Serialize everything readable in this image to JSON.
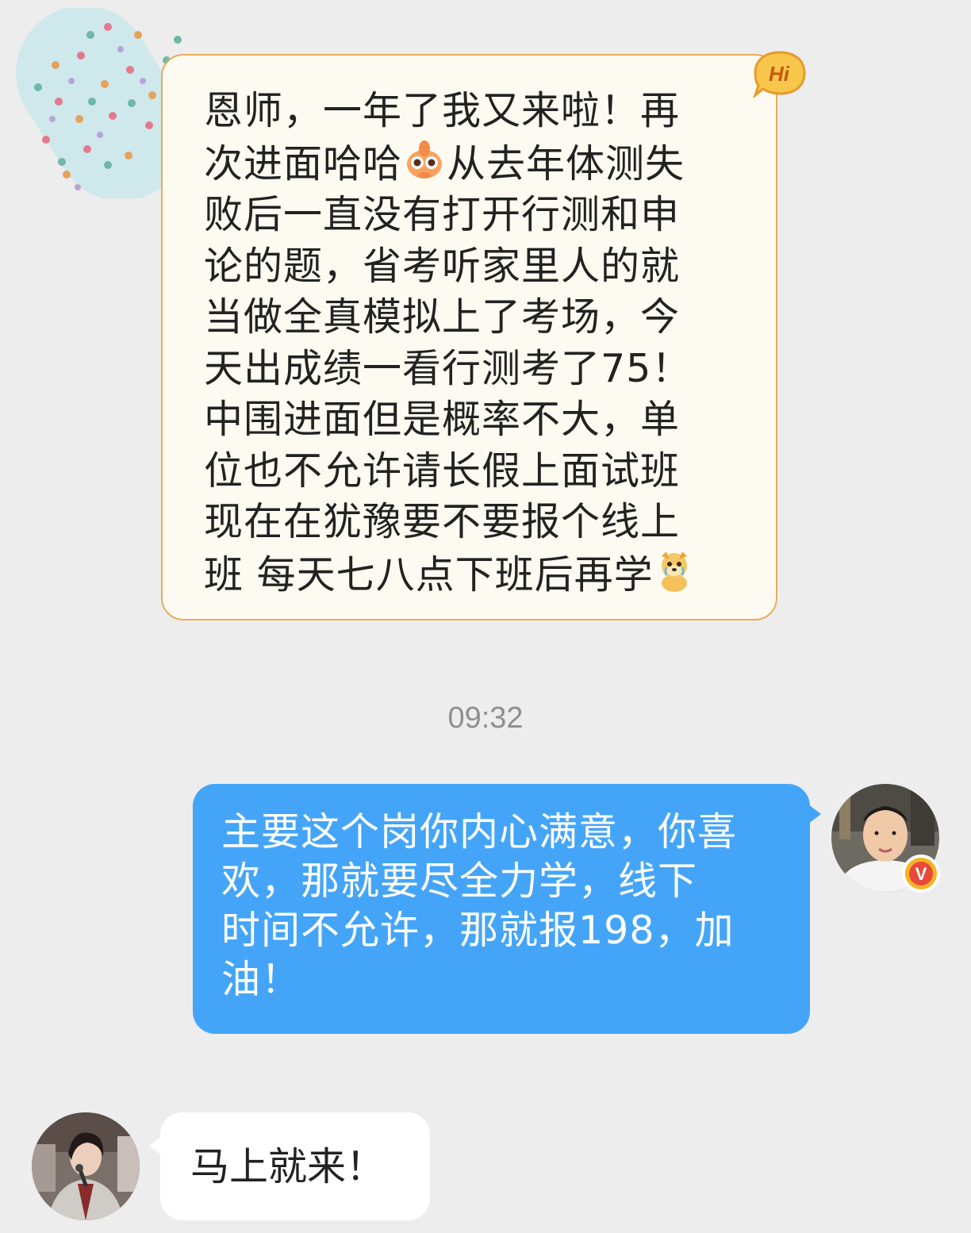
{
  "messages": {
    "incoming_1": {
      "text": "恩师，一年了我又来啦！再\n次进面哈哈",
      "text_part2": "从去年体测失\n败后一直没有打开行测和申\n论的题，省考听家里人的就\n当做全真模拟上了考场，今\n天出成绩一看行测考了75！\n中围进面但是概率不大，单\n位也不允许请长假上面试班\n现在在犹豫要不要报个线上\n班 每天七八点下班后再学",
      "badge_text": "Hi"
    },
    "timestamp": "09:32",
    "outgoing_1": {
      "text": "主要这个岗你内心满意，你喜\n欢，那就要尽全力学，线下\n时间不允许，那就报198，加\n油！",
      "verified_badge": "V"
    },
    "incoming_2": {
      "text": "马上就来！"
    }
  },
  "icons": {
    "sender_avatar_left_top": "polka-dot-avatar",
    "emoji_1": "peek-emoji-icon",
    "emoji_2": "crying-dog-emoji-icon",
    "receiver_avatar": "user-photo-avatar",
    "sender_avatar_bottom": "user-photo-avatar"
  },
  "colors": {
    "background": "#ededed",
    "incoming_highlight_bg": "#fdfbf1",
    "incoming_highlight_border": "#e7ac5a",
    "outgoing_bubble": "#44a5f8",
    "incoming_bubble": "#ffffff",
    "timestamp": "#8f8f8f"
  }
}
